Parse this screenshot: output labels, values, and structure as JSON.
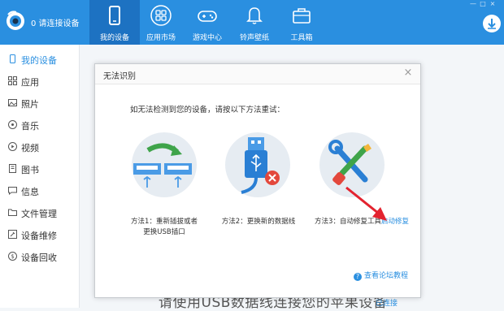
{
  "header": {
    "device_status": "0 请连接设备",
    "nav": [
      {
        "label": "我的设备",
        "icon": "phone-icon"
      },
      {
        "label": "应用市场",
        "icon": "apps-grid-icon"
      },
      {
        "label": "游戏中心",
        "icon": "gamepad-icon"
      },
      {
        "label": "铃声壁纸",
        "icon": "bell-icon"
      },
      {
        "label": "工具箱",
        "icon": "toolbox-icon"
      }
    ],
    "window_controls": [
      "—",
      "□",
      "×"
    ]
  },
  "sidebar": {
    "items": [
      {
        "label": "我的设备",
        "icon": "device-icon"
      },
      {
        "label": "应用",
        "icon": "apps-icon"
      },
      {
        "label": "照片",
        "icon": "photo-icon"
      },
      {
        "label": "音乐",
        "icon": "music-icon"
      },
      {
        "label": "视频",
        "icon": "video-icon"
      },
      {
        "label": "图书",
        "icon": "book-icon"
      },
      {
        "label": "信息",
        "icon": "message-icon"
      },
      {
        "label": "文件管理",
        "icon": "folder-icon"
      },
      {
        "label": "设备维修",
        "icon": "repair-icon"
      },
      {
        "label": "设备回收",
        "icon": "recycle-icon"
      }
    ]
  },
  "main": {
    "bottom_text": "请使用USB数据线连接您的苹果设备",
    "connected_text": "已连接"
  },
  "dialog": {
    "title": "无法识别",
    "close": "×",
    "intro": "如无法检测到您的设备，请按以下方法重试：",
    "method1_line1": "方法1：重新插拔或者",
    "method1_line2": "更换USB插口",
    "method2": "方法2：更换新的数据线",
    "method3": "方法3：自动修复工具",
    "auto_repair_link": "启动修复",
    "forum_link": "查看论坛教程",
    "forum_icon_text": "?"
  },
  "colors": {
    "primary": "#2a8fe0",
    "active_nav": "#1d72c2",
    "circle_bg": "#e6ecf2",
    "red_arrow": "#e3232f"
  }
}
